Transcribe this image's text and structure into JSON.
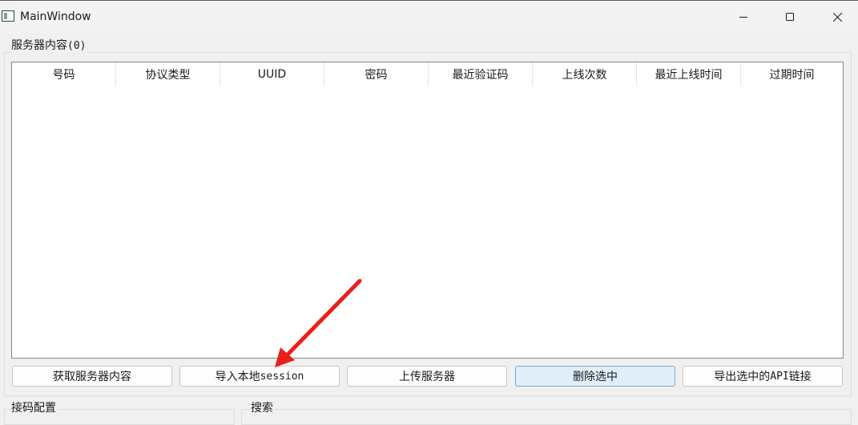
{
  "window": {
    "title": "MainWindow"
  },
  "group": {
    "title": "服务器内容",
    "count": "(0)"
  },
  "table": {
    "columns": [
      "号码",
      "协议类型",
      "UUID",
      "密码",
      "最近验证码",
      "上线次数",
      "最近上线时间",
      "过期时间"
    ],
    "rows": []
  },
  "buttons": {
    "fetch": "获取服务器内容",
    "import_prefix": "导入本地",
    "import_suffix": "session",
    "upload": "上传服务器",
    "delete": "删除选中",
    "export_prefix": "导出选中的",
    "export_api": "API",
    "export_suffix": "链接"
  },
  "bottom": {
    "receive_config": "接码配置",
    "search": "搜索"
  },
  "colors": {
    "annotation_arrow": "#e8201c",
    "focused_button": "#e0eef9"
  },
  "icons": {
    "app": "app-window-icon",
    "minimize": "minimize-icon",
    "maximize": "maximize-icon",
    "close": "close-icon",
    "annotation": "red-arrow-annotation"
  }
}
